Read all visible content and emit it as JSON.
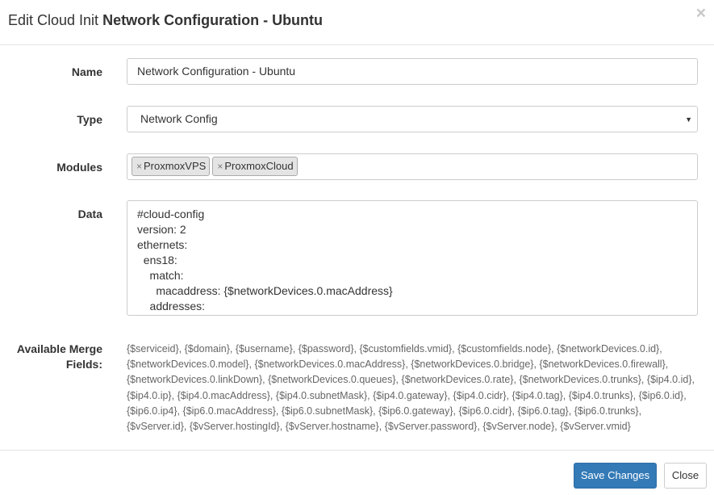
{
  "modal": {
    "title_prefix": "Edit Cloud Init",
    "title_main": "Network Configuration - Ubuntu",
    "close_glyph": "×"
  },
  "form": {
    "name_label": "Name",
    "name_value": "Network Configuration - Ubuntu",
    "type_label": "Type",
    "type_value": "Network Config",
    "modules_label": "Modules",
    "modules": [
      "ProxmoxVPS",
      "ProxmoxCloud"
    ],
    "tag_remove_glyph": "×",
    "data_label": "Data",
    "data_lines": [
      "#cloud-config",
      "version: 2",
      "ethernets:",
      "  ens18:",
      "    match:",
      "      macaddress: {$networkDevices.0.macAddress}",
      "    addresses:"
    ],
    "merge_label_line1": "Available Merge",
    "merge_label_line2": "Fields:",
    "merge_fields": [
      "{$serviceid}",
      "{$domain}",
      "{$username}",
      "{$password}",
      "{$customfields.vmid}",
      "{$customfields.node}",
      "{$networkDevices.0.id}",
      "{$networkDevices.0.model}",
      "{$networkDevices.0.macAddress}",
      "{$networkDevices.0.bridge}",
      "{$networkDevices.0.firewall}",
      "{$networkDevices.0.linkDown}",
      "{$networkDevices.0.queues}",
      "{$networkDevices.0.rate}",
      "{$networkDevices.0.trunks}",
      "{$ip4.0.id}",
      "{$ip4.0.ip}",
      "{$ip4.0.macAddress}",
      "{$ip4.0.subnetMask}",
      "{$ip4.0.gateway}",
      "{$ip4.0.cidr}",
      "{$ip4.0.tag}",
      "{$ip4.0.trunks}",
      "{$ip6.0.id}",
      "{$ip6.0.ip4}",
      "{$ip6.0.macAddress}",
      "{$ip6.0.subnetMask}",
      "{$ip6.0.gateway}",
      "{$ip6.0.cidr}",
      "{$ip6.0.tag}",
      "{$ip6.0.trunks}",
      "{$vServer.id}",
      "{$vServer.hostingId}",
      "{$vServer.hostname}",
      "{$vServer.password}",
      "{$vServer.node}",
      "{$vServer.vmid}"
    ]
  },
  "footer": {
    "save_label": "Save Changes",
    "close_label": "Close"
  },
  "colors": {
    "primary": "#337ab7",
    "border": "#cccccc",
    "muted_text": "#666666"
  }
}
